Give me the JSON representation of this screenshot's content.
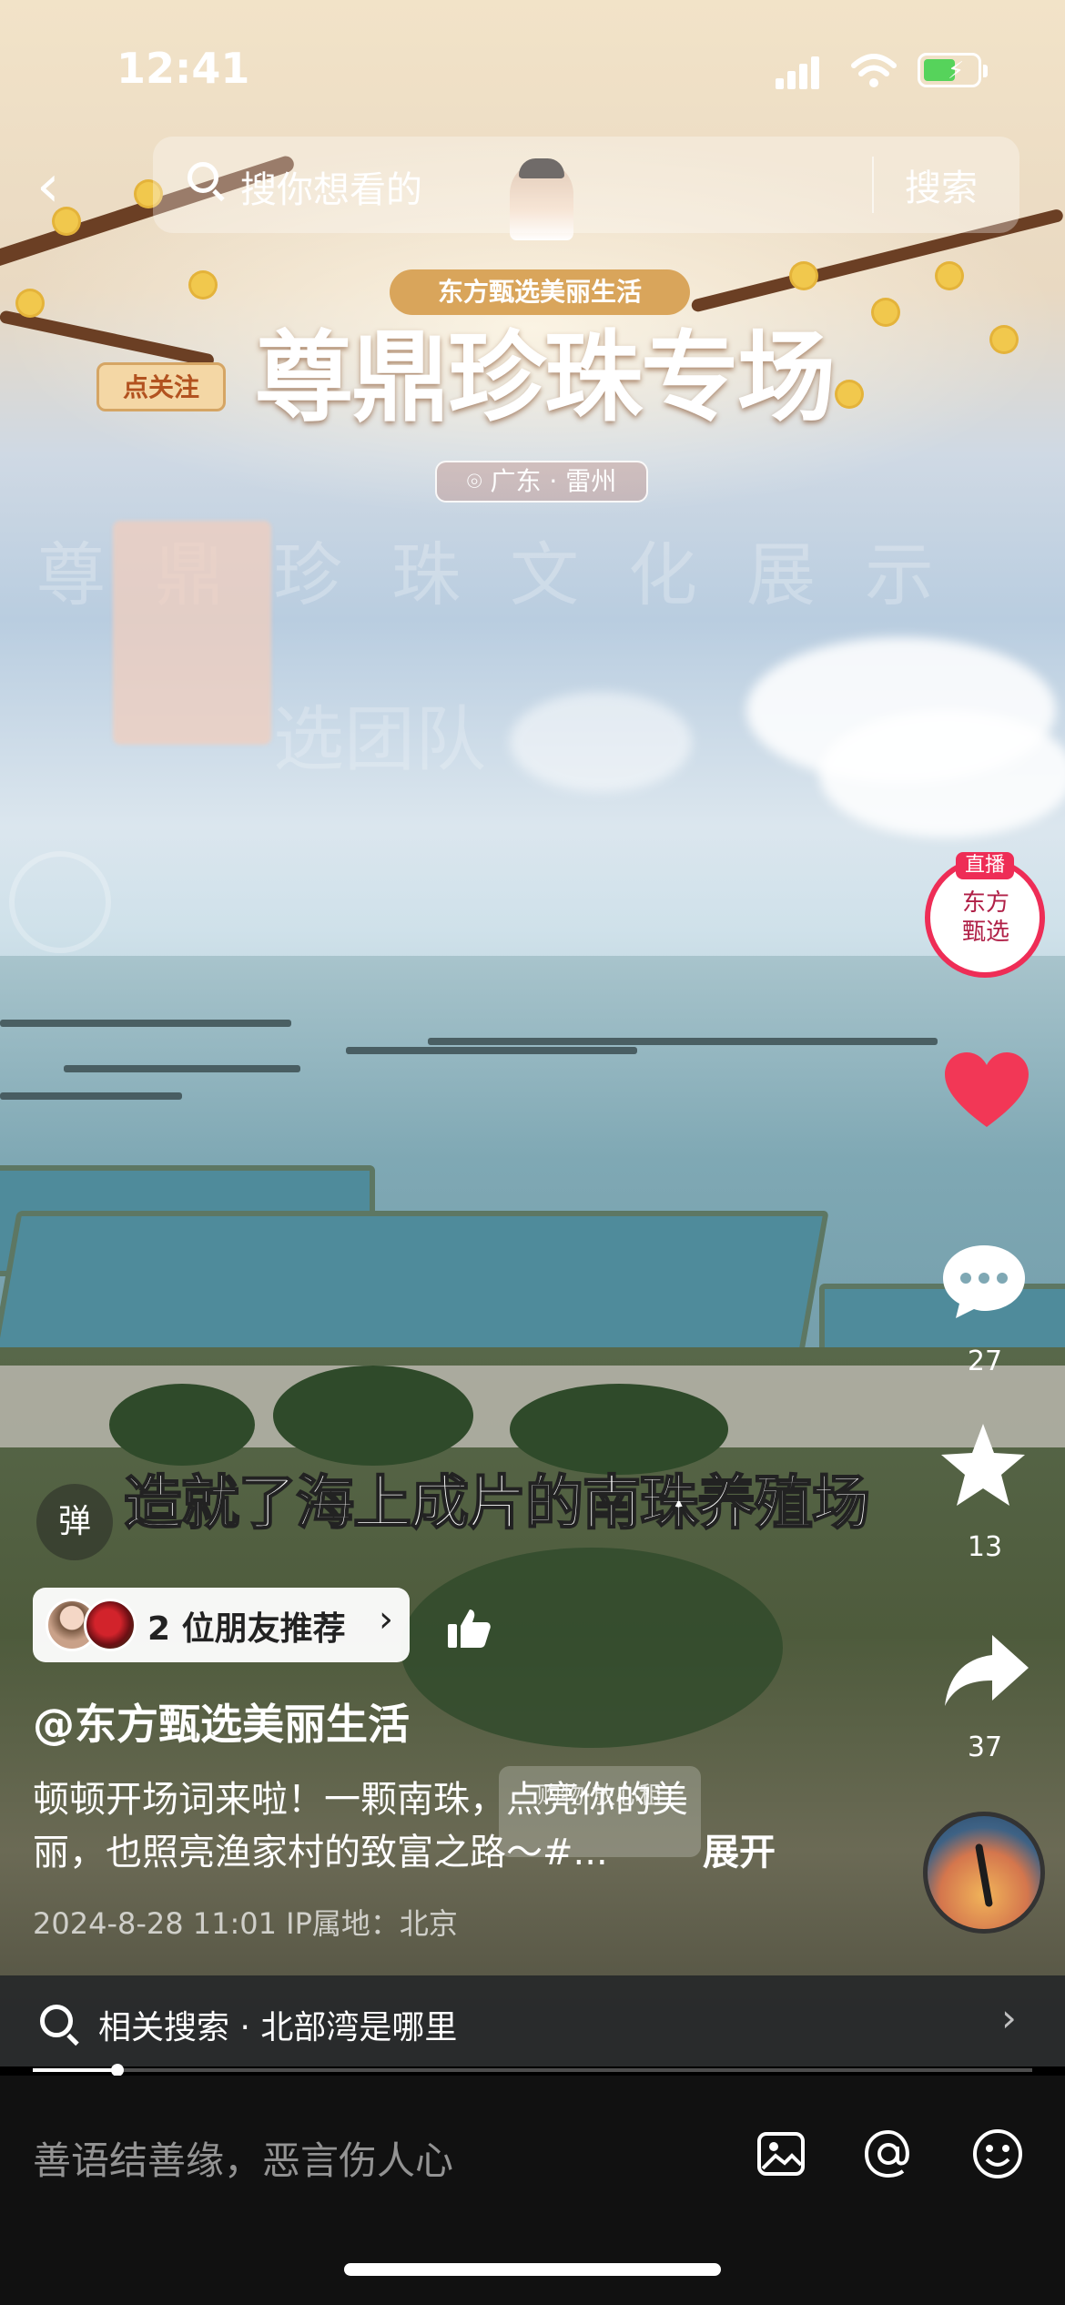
{
  "status_bar": {
    "time": "12:41"
  },
  "search": {
    "placeholder": "搜你想看的",
    "button": "搜索"
  },
  "banner": {
    "brand_pill": "东方甄选美丽生活",
    "follow": "点关注",
    "title": "尊鼎珍珠专场",
    "location": "广东 · 雷州",
    "ghost_line_1": "尊鼎珍珠文化展示",
    "ghost_line_2": "选团队"
  },
  "right_rail": {
    "live_tag": "直播",
    "live_logo": "东方甄选",
    "comments": "27",
    "favorites": "13",
    "shares": "37"
  },
  "video": {
    "caption": "造就了海上成片的南珠养殖场",
    "danmu_button": "弹",
    "shop_overlay": "购物·放心租"
  },
  "post": {
    "friends": "2 位朋友推荐",
    "author": "@东方甄选美丽生活",
    "desc_line_1": "顿顿开场词来啦！一颗南珠，点亮你的美",
    "desc_line_2": "丽，也照亮渔家村的致富之路～#...",
    "expand": "展开",
    "meta": "2024-8-28 11:01 IP属地：北京"
  },
  "related": {
    "text": "相关搜索 · 北部湾是哪里"
  },
  "progress": {
    "fraction": 0.085
  },
  "comment_bar": {
    "placeholder": "善语结善缘，恶言伤人心"
  },
  "icons": [
    "back-icon",
    "search-icon",
    "signal-icon",
    "wifi-icon",
    "battery-icon",
    "heart-icon",
    "comment-icon",
    "star-icon",
    "share-icon",
    "thumbs-up-icon",
    "image-icon",
    "at-icon",
    "emoji-icon",
    "chevron-right-icon"
  ],
  "colors": {
    "live_red": "#ee2d56",
    "heart_red": "#f23756",
    "pill_gold": "#d9a55b"
  }
}
